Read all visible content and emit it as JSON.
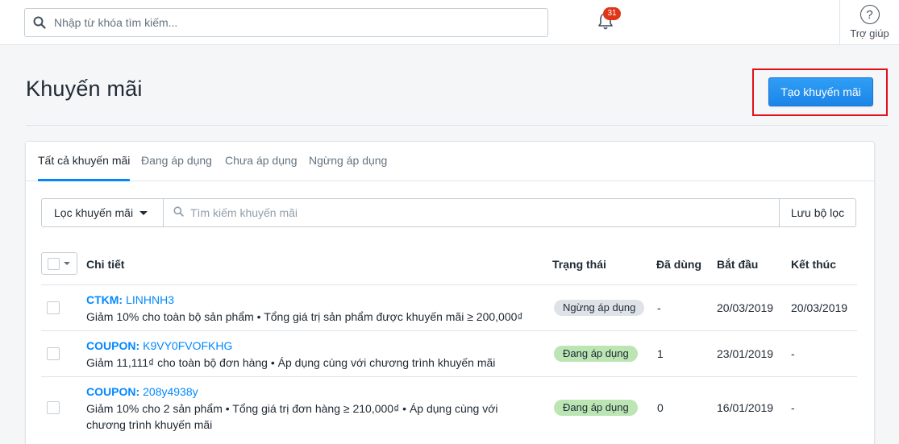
{
  "topbar": {
    "search_placeholder": "Nhập từ khóa tìm kiếm...",
    "notification_count": "31",
    "help_label": "Trợ giúp",
    "help_symbol": "?"
  },
  "page": {
    "title": "Khuyến mãi",
    "create_button": "Tạo khuyến mãi"
  },
  "tabs": [
    {
      "label": "Tất cả khuyến mãi",
      "active": true
    },
    {
      "label": "Đang áp dụng",
      "active": false
    },
    {
      "label": "Chưa áp dụng",
      "active": false
    },
    {
      "label": "Ngừng áp dụng",
      "active": false
    }
  ],
  "filter": {
    "dropdown_label": "Lọc khuyến mãi",
    "search_placeholder": "Tìm kiếm khuyến mãi",
    "save_label": "Lưu bộ lọc"
  },
  "table": {
    "headers": {
      "detail": "Chi tiết",
      "status": "Trạng thái",
      "used": "Đã dùng",
      "start": "Bắt đầu",
      "end": "Kết thúc"
    },
    "rows": [
      {
        "kind": "CTKM:",
        "code": "LINHNH3",
        "description": "Giảm 10% cho toàn bộ sản phẩm • Tổng giá trị sản phẩm được khuyến mãi ≥ 200,000₫",
        "status": "Ngừng áp dụng",
        "used": "-",
        "start": "20/03/2019",
        "end": "20/03/2019"
      },
      {
        "kind": "COUPON:",
        "code": "K9VY0FVOFKHG",
        "description": "Giảm 11,111₫ cho toàn bộ đơn hàng • Áp dụng cùng với chương trình khuyến mãi",
        "status": "Đang áp dụng",
        "used": "1",
        "start": "23/01/2019",
        "end": "-"
      },
      {
        "kind": "COUPON:",
        "code": "208y4938y",
        "description_line1": "Giảm 10% cho 2 sản phẩm • Tổng giá trị đơn hàng ≥ 210,000₫ • Áp dụng cùng với",
        "description_line2": "chương trình khuyến mãi",
        "status": "Đang áp dụng",
        "used": "0",
        "start": "16/01/2019",
        "end": "-"
      }
    ]
  },
  "colors": {
    "accent": "#0088ff",
    "status_active": "#bbe5b3",
    "status_stopped": "#dfe3e8",
    "highlight_frame": "#e3101a",
    "badge": "#de3618"
  }
}
